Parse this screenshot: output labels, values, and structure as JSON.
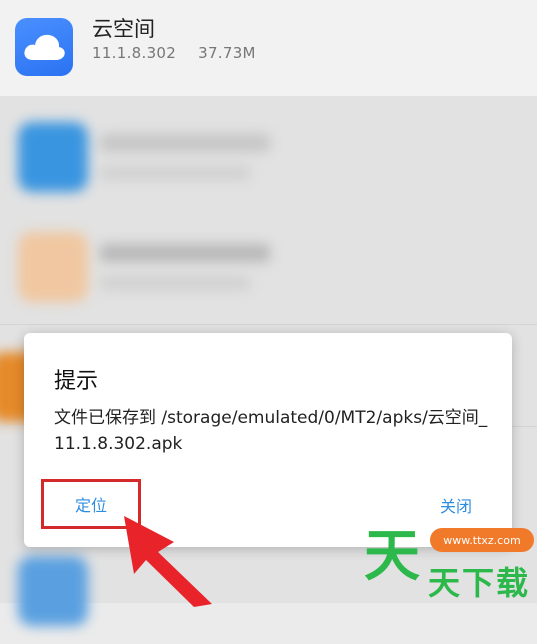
{
  "app": {
    "name": "云空间",
    "version": "11.1.8.302",
    "size": "37.73M"
  },
  "dialog": {
    "title": "提示",
    "message": "文件已保存到 /storage/emulated/0/MT2/apks/云空间_11.1.8.302.apk",
    "locate_label": "定位",
    "close_label": "关闭"
  },
  "watermark": {
    "site": "www.ttxz.com",
    "big_char": "天",
    "small_text": "天下载"
  },
  "colors": {
    "accent": "#2f8de0",
    "highlight": "#d42a2a",
    "arrow": "#e8232a",
    "watermark_green": "#2cb84a",
    "watermark_orange": "#f07a2a"
  }
}
